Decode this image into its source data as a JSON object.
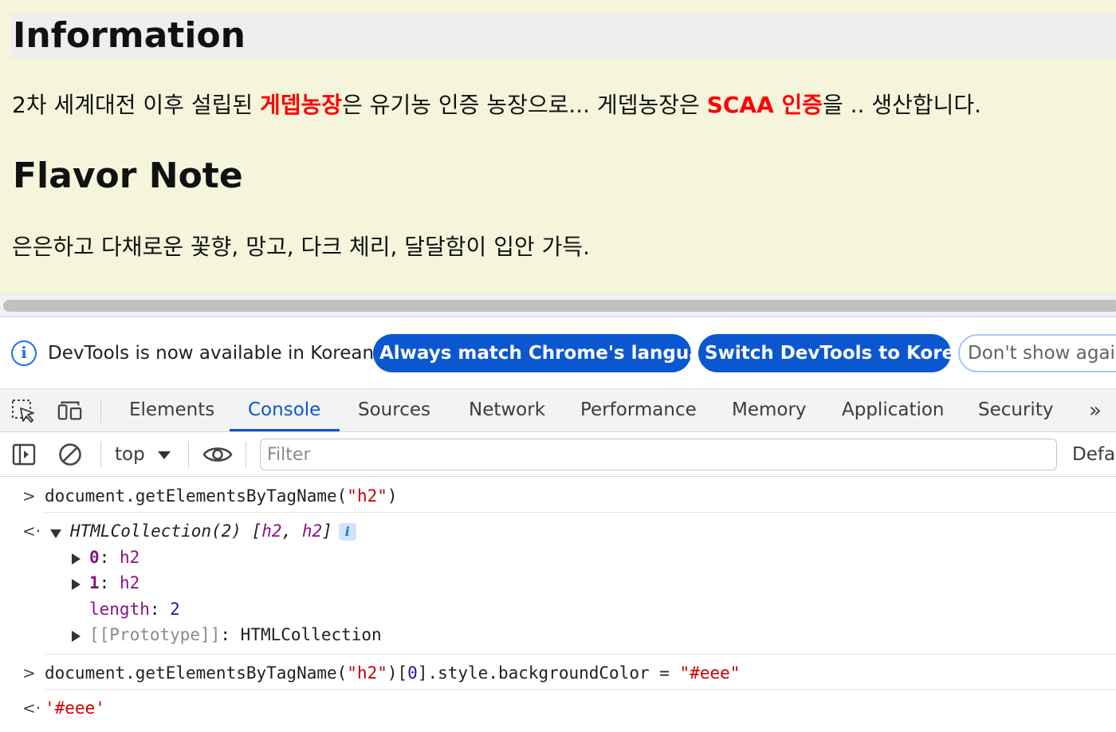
{
  "page": {
    "heading_info": "Information",
    "info_para": {
      "part1": "2차 세계대전 이후 설립된 ",
      "highlight1": "게뎁농장",
      "part2": "은 유기농 인증 농장으로... 게뎁농장은 ",
      "highlight2": "SCAA 인증",
      "part3": "을 .. 생산합니다."
    },
    "heading_flavor": "Flavor Note",
    "flavor_para": "은은하고 다채로운 꽃향, 망고, 다크 체리, 달달함이 입안 가득."
  },
  "infobar": {
    "icon": "info-icon",
    "message": "DevTools is now available in Korean!",
    "btn_match": "Always match Chrome's language",
    "btn_switch": "Switch DevTools to Korean",
    "btn_dont_show": "Don't show again"
  },
  "tabs": {
    "items": [
      "Elements",
      "Console",
      "Sources",
      "Network",
      "Performance",
      "Memory",
      "Application",
      "Security"
    ],
    "active": "Console",
    "more": "»"
  },
  "toolbar": {
    "context": "top",
    "filter_placeholder": "Filter",
    "levels": "Default levels"
  },
  "console": {
    "cmd1": {
      "fn": "document.getElementsByTagName(",
      "arg": "\"h2\"",
      "close": ")"
    },
    "result1": {
      "label": "HTMLCollection(2)",
      "preview_open": " [",
      "item_a": "h2",
      "comma": ", ",
      "item_b": "h2",
      "preview_close": "]",
      "badge": "i",
      "entries": [
        {
          "key": "0",
          "value": "h2"
        },
        {
          "key": "1",
          "value": "h2"
        }
      ],
      "length_key": "length",
      "length_value": "2",
      "proto_key": "[[Prototype]]",
      "proto_value": "HTMLCollection"
    },
    "cmd2": {
      "fn": "document.getElementsByTagName(",
      "arg": "\"h2\"",
      "mid": ")[",
      "index": "0",
      "rest": "].style.backgroundColor = ",
      "value": "\"#eee\""
    },
    "result2": "'#eee'"
  },
  "colors": {
    "page_bg": "#f5f5dc",
    "heading_bg": "#eeeeee",
    "highlight": "#ff0000",
    "accent": "#0b57d0"
  }
}
